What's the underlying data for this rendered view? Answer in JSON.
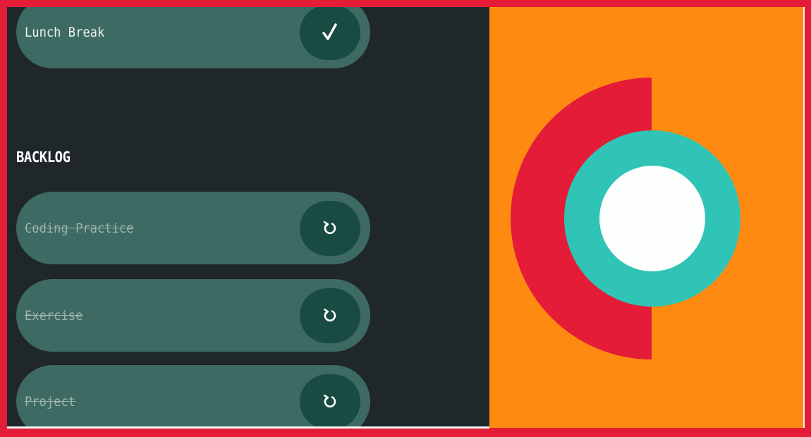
{
  "colors": {
    "frame_border": "#e41c38",
    "list_background": "#20272a",
    "card_background": "#3d6a62",
    "card_button": "#184b42",
    "right_background": "#fe8a12",
    "ring_red": "#e41c38",
    "ring_teal": "#2fc4b6",
    "ring_center": "#fcfffd"
  },
  "tasks_top": [
    {
      "label": "Lunch Break",
      "status": "done",
      "icon": "check-icon"
    }
  ],
  "backlog": {
    "title": "BACKLOG",
    "items": [
      {
        "label": "Coding Practice",
        "status": "completed",
        "icon": "redo-icon"
      },
      {
        "label": "Exercise",
        "status": "completed",
        "icon": "redo-icon"
      },
      {
        "label": "Project",
        "status": "completed",
        "icon": "redo-icon"
      }
    ]
  }
}
